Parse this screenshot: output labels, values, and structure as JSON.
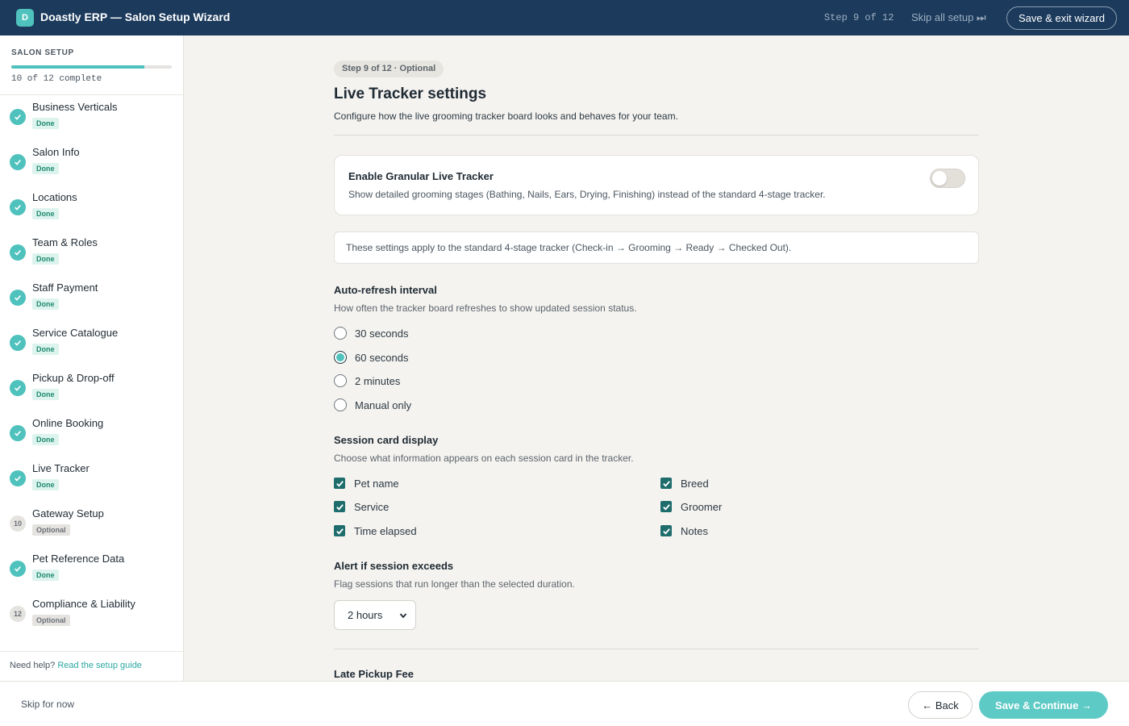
{
  "header": {
    "logo_letter": "D",
    "title": "Doastly ERP — Salon Setup Wizard",
    "step_counter": "Step 9 of 12",
    "skip_all": "Skip all setup ⏭",
    "save_exit": "Save & exit wizard"
  },
  "sidebar": {
    "title": "SALON SETUP",
    "progress_fraction": 0.83,
    "progress_text": "10 of 12 complete",
    "steps": [
      {
        "label": "Business Verticals",
        "status": "Done",
        "marker": "check"
      },
      {
        "label": "Salon Info",
        "status": "Done",
        "marker": "check"
      },
      {
        "label": "Locations",
        "status": "Done",
        "marker": "check"
      },
      {
        "label": "Team & Roles",
        "status": "Done",
        "marker": "check"
      },
      {
        "label": "Staff Payment",
        "status": "Done",
        "marker": "check"
      },
      {
        "label": "Service Catalogue",
        "status": "Done",
        "marker": "check"
      },
      {
        "label": "Pickup & Drop-off",
        "status": "Done",
        "marker": "check"
      },
      {
        "label": "Online Booking",
        "status": "Done",
        "marker": "check"
      },
      {
        "label": "Live Tracker",
        "status": "Done",
        "marker": "check"
      },
      {
        "label": "Gateway Setup",
        "status": "Optional",
        "marker": "10"
      },
      {
        "label": "Pet Reference Data",
        "status": "Done",
        "marker": "check"
      },
      {
        "label": "Compliance & Liability",
        "status": "Optional",
        "marker": "12"
      }
    ],
    "help_text": "Need help?",
    "help_link": "Read the setup guide"
  },
  "main": {
    "step_pill": "Step 9 of 12 · Optional",
    "title": "Live Tracker settings",
    "description": "Configure how the live grooming tracker board looks and behaves for your team.",
    "toggle_card": {
      "title": "Enable Granular Live Tracker",
      "description": "Show detailed grooming stages (Bathing, Nails, Ears, Drying, Finishing) instead of the standard 4-stage tracker.",
      "enabled": false
    },
    "info_note": "These settings apply to the standard 4-stage tracker (Check-in → Grooming → Ready → Checked Out).",
    "auto_refresh": {
      "title": "Auto-refresh interval",
      "description": "How often the tracker board refreshes to show updated session status.",
      "options": [
        "30 seconds",
        "60 seconds",
        "2 minutes",
        "Manual only"
      ],
      "selected": "60 seconds"
    },
    "card_display": {
      "title": "Session card display",
      "description": "Choose what information appears on each session card in the tracker.",
      "options": [
        {
          "label": "Pet name",
          "checked": true
        },
        {
          "label": "Service",
          "checked": true
        },
        {
          "label": "Time elapsed",
          "checked": true
        },
        {
          "label": "Breed",
          "checked": true
        },
        {
          "label": "Groomer",
          "checked": true
        },
        {
          "label": "Notes",
          "checked": true
        }
      ]
    },
    "alert": {
      "title": "Alert if session exceeds",
      "description": "Flag sessions that run longer than the selected duration.",
      "selected": "2 hours"
    },
    "late_pickup_title": "Late Pickup Fee"
  },
  "footer": {
    "skip_now": "Skip for now",
    "back": "← Back",
    "continue": "Save & Continue →"
  },
  "colors": {
    "header_bg": "#1b3a5c",
    "accent": "#4fc2bd",
    "checkbox": "#1e6d6c"
  }
}
